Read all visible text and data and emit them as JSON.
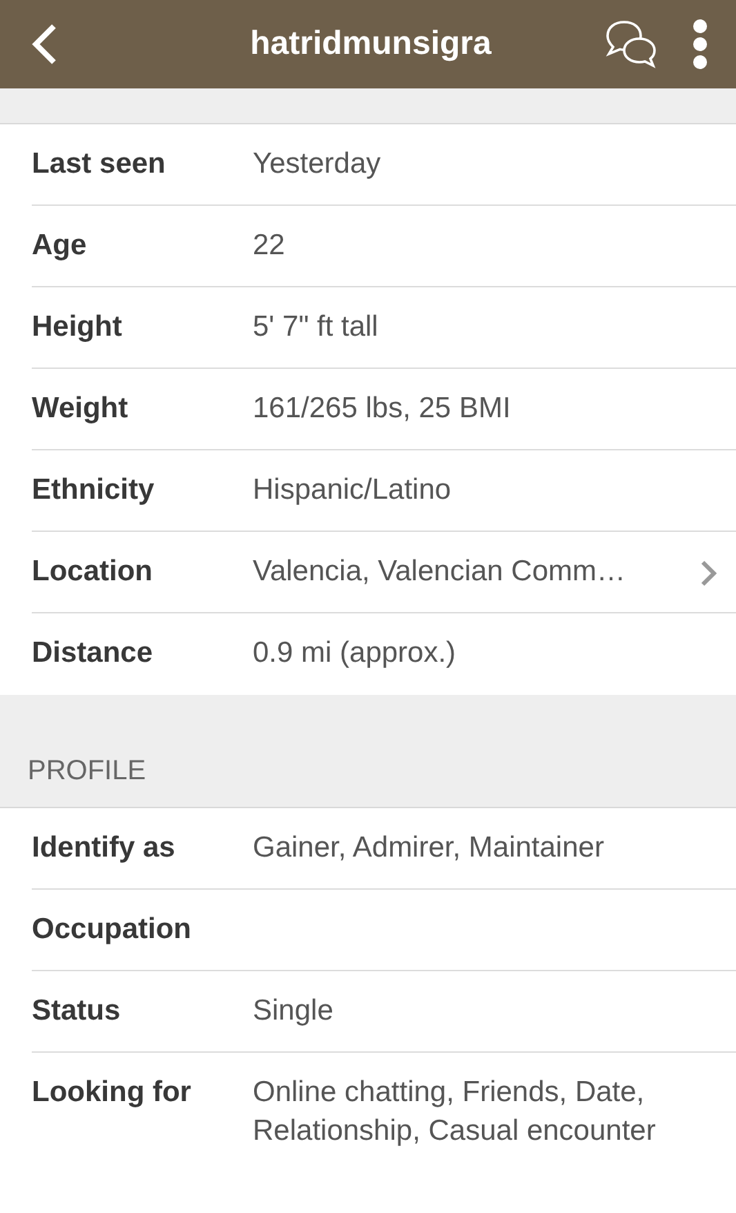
{
  "app_bar": {
    "title": "hatridmunsigra"
  },
  "details": {
    "rows": [
      {
        "label": "Last seen",
        "value": "Yesterday"
      },
      {
        "label": "Age",
        "value": "22"
      },
      {
        "label": "Height",
        "value": "5' 7\" ft tall"
      },
      {
        "label": "Weight",
        "value": "161/265 lbs, 25 BMI"
      },
      {
        "label": "Ethnicity",
        "value": "Hispanic/Latino"
      },
      {
        "label": "Location",
        "value": "Valencia, Valencian Comm…",
        "kind": "link"
      },
      {
        "label": "Distance",
        "value": "0.9 mi (approx.)"
      }
    ]
  },
  "profile": {
    "heading": "PROFILE",
    "rows": [
      {
        "label": "Identify as",
        "value": "Gainer, Admirer, Maintainer"
      },
      {
        "label": "Occupation"
      },
      {
        "label": "Status",
        "value": "Single"
      },
      {
        "label": "Looking for",
        "value": "Online chatting, Friends, Date, Relationship, Casual encounter"
      }
    ]
  }
}
